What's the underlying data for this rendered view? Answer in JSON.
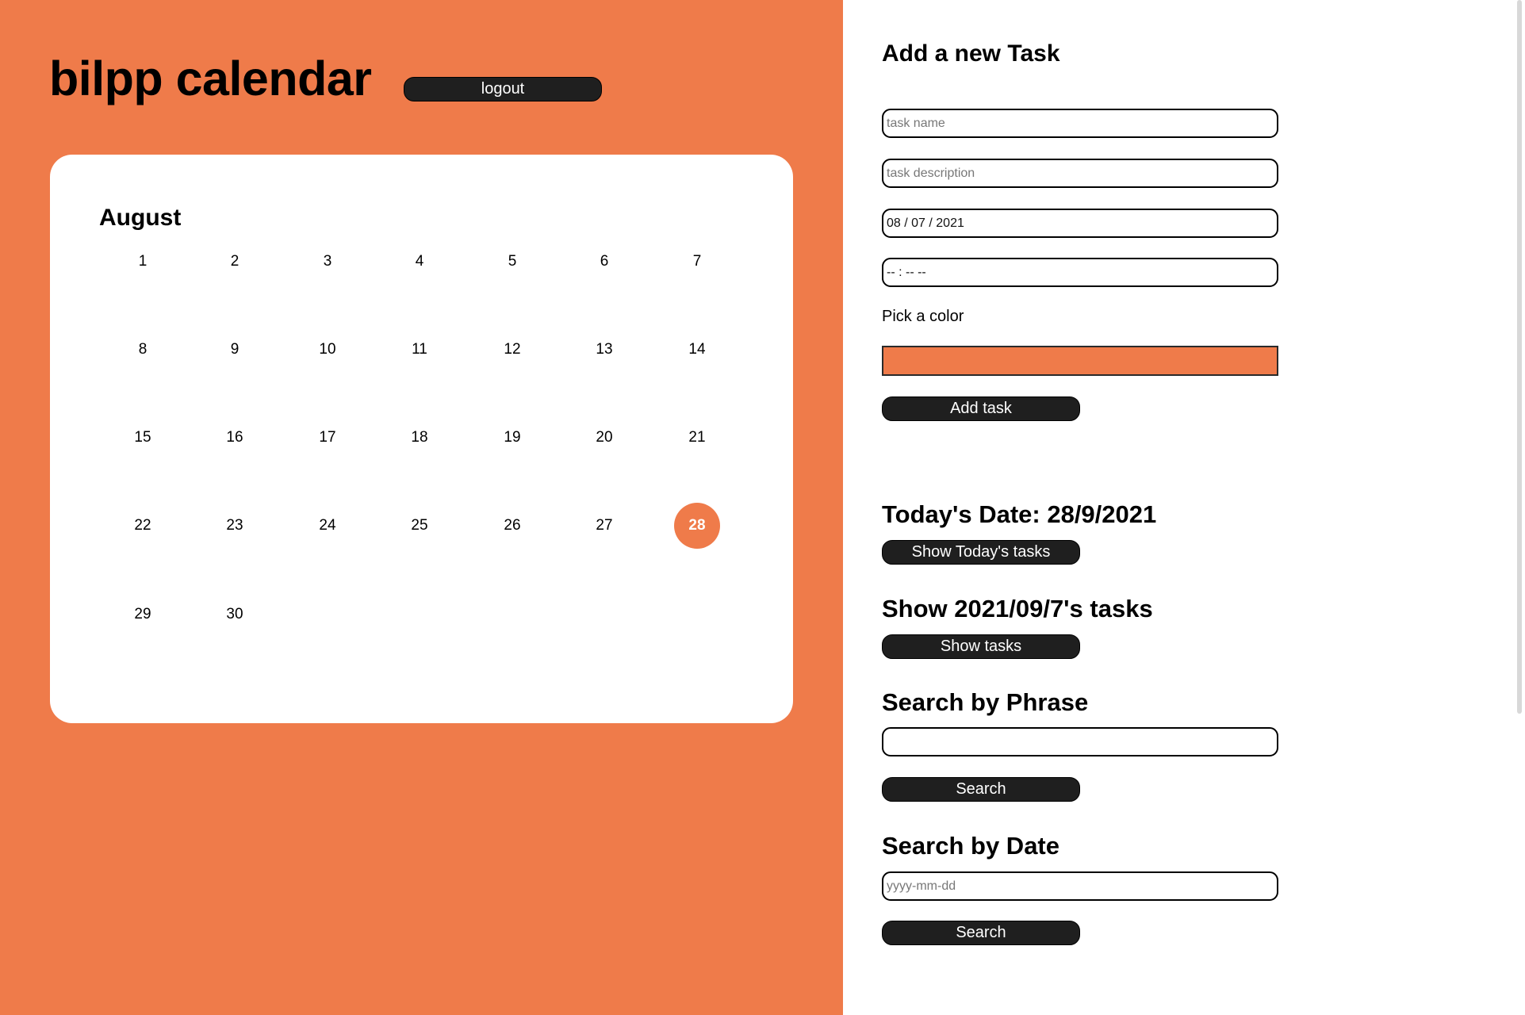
{
  "app": {
    "title": "bilpp calendar",
    "logout_label": "logout",
    "accent_color": "#ef7b4a"
  },
  "calendar": {
    "month": "August",
    "weeks": [
      [
        "1",
        "2",
        "3",
        "4",
        "5",
        "6",
        "7"
      ],
      [
        "8",
        "9",
        "10",
        "11",
        "12",
        "13",
        "14"
      ],
      [
        "15",
        "16",
        "17",
        "18",
        "19",
        "20",
        "21"
      ],
      [
        "22",
        "23",
        "24",
        "25",
        "26",
        "27",
        "28"
      ],
      [
        "29",
        "30"
      ]
    ],
    "highlighted_day": "28"
  },
  "add_task": {
    "heading": "Add a new Task",
    "name_placeholder": "task name",
    "description_placeholder": "task description",
    "date_value": "08 / 07 / 2021",
    "time_value": "-- : --  --",
    "color_label": "Pick a color",
    "color_value": "#ef7b4a",
    "submit_label": "Add task"
  },
  "today": {
    "heading": "Today's Date: 28/9/2021",
    "button_label": "Show Today's tasks"
  },
  "day_tasks": {
    "heading": "Show 2021/09/7's tasks",
    "button_label": "Show tasks"
  },
  "search_phrase": {
    "heading": "Search by Phrase",
    "value": "",
    "button_label": "Search"
  },
  "search_date": {
    "heading": "Search by Date",
    "placeholder": "yyyy-mm-dd",
    "button_label": "Search"
  }
}
